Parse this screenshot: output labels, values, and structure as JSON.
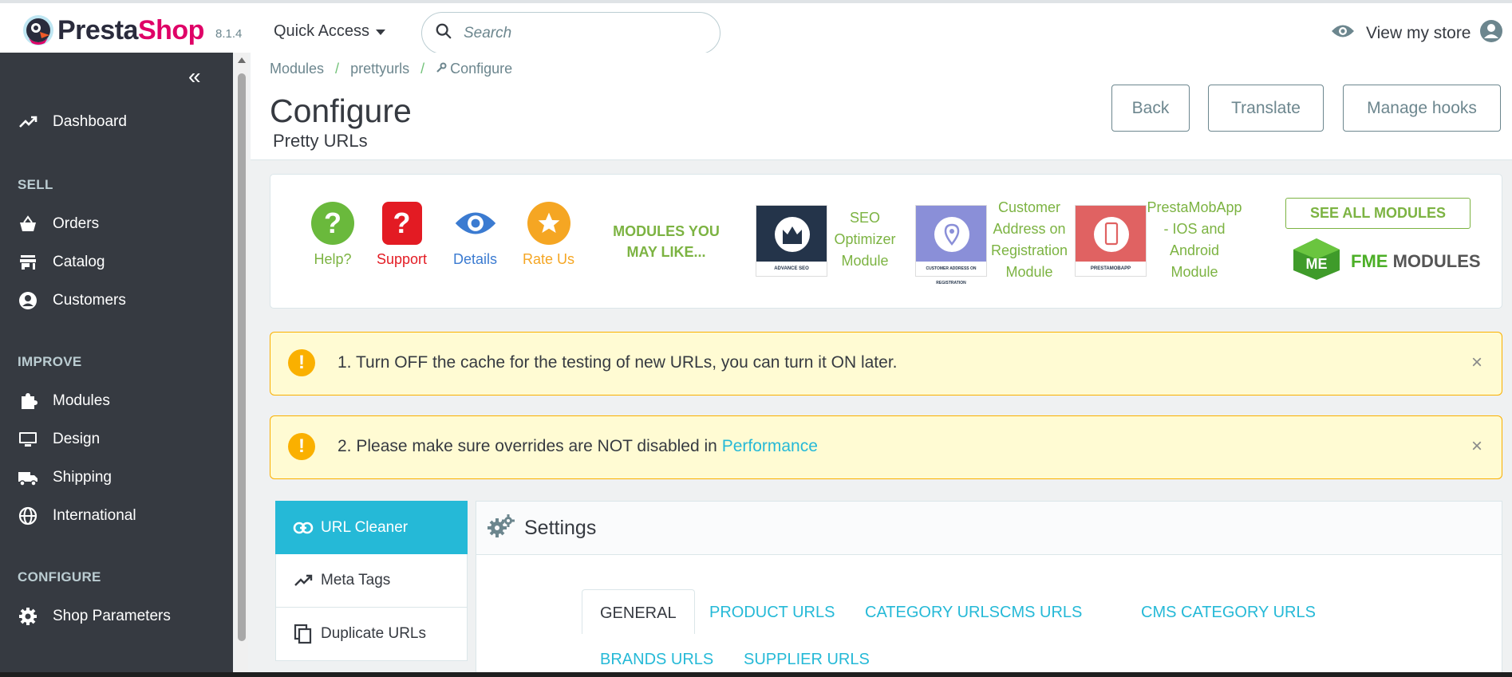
{
  "header": {
    "logo_presta": "Presta",
    "logo_shop": "Shop",
    "version": "8.1.4",
    "quick_access": "Quick Access",
    "search_placeholder": "Search",
    "view_store": "View my store"
  },
  "sidebar": {
    "items": [
      {
        "label": "Dashboard",
        "icon": "trending-up-icon"
      },
      {
        "label": "Orders",
        "icon": "basket-icon"
      },
      {
        "label": "Catalog",
        "icon": "store-icon"
      },
      {
        "label": "Customers",
        "icon": "account-circle-icon"
      },
      {
        "label": "Modules",
        "icon": "puzzle-icon"
      },
      {
        "label": "Design",
        "icon": "monitor-icon"
      },
      {
        "label": "Shipping",
        "icon": "truck-icon"
      },
      {
        "label": "International",
        "icon": "globe-icon"
      },
      {
        "label": "Shop Parameters",
        "icon": "gear-icon"
      }
    ],
    "sections": [
      "SELL",
      "IMPROVE",
      "CONFIGURE"
    ]
  },
  "page_head": {
    "breadcrumb": [
      "Modules",
      "prettyurls",
      "Configure"
    ],
    "title": "Configure",
    "subtitle": "Pretty URLs",
    "buttons": {
      "back": "Back",
      "translate": "Translate",
      "manage_hooks": "Manage hooks"
    }
  },
  "modules_card": {
    "actions": {
      "help": "Help?",
      "support": "Support",
      "details": "Details",
      "rate": "Rate Us"
    },
    "may_like": "MODULES YOU MAY LIKE...",
    "promos": [
      {
        "thumb_caption": "ADVANCE SEO",
        "lines": [
          "SEO",
          "Optimizer",
          "Module"
        ]
      },
      {
        "thumb_caption": "CUSTOMER ADDRESS ON REGISTRATION",
        "lines": [
          "Customer",
          "Address on",
          "Registration",
          "Module"
        ]
      },
      {
        "thumb_caption": "PRESTAMOBAPP",
        "lines": [
          "PrestaMobApp",
          "- IOS and",
          "Android",
          "Module"
        ]
      }
    ],
    "see_all": "SEE ALL MODULES",
    "fme_logo_fme": "FME",
    "fme_logo_modules": " MODULES"
  },
  "alerts": {
    "first": "1. Turn OFF the cache for the testing of new URLs, you can turn it ON later.",
    "second_prefix": "2. Please make sure overrides are NOT disabled in ",
    "second_link": "Performance"
  },
  "side_tabs": [
    {
      "label": "URL Cleaner",
      "active": true
    },
    {
      "label": "Meta Tags",
      "active": false
    },
    {
      "label": "Duplicate URLs",
      "active": false
    }
  ],
  "settings": {
    "title": "Settings",
    "tabs": [
      "GENERAL",
      "PRODUCT URLS",
      "CATEGORY URLS",
      "CMS URLS",
      "CMS CATEGORY URLS",
      "BRANDS URLS",
      "SUPPLIER URLS"
    ]
  },
  "colors": {
    "sidebar_bg": "#363a41",
    "accent": "#25b9d7",
    "brand_pink": "#df0067",
    "green": "#7cb342",
    "warning": "#fab000"
  }
}
